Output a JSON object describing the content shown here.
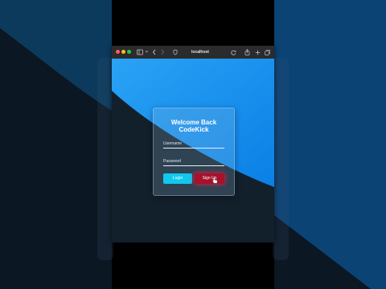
{
  "browser": {
    "address": "localhost",
    "toolbar_icons": {
      "sidebar": "sidebar-icon",
      "back": "chevron-left-icon",
      "forward": "chevron-right-icon",
      "shield": "shield-icon",
      "reload": "reload-icon",
      "share": "share-icon",
      "new_tab": "plus-icon",
      "tabs": "tabs-icon"
    }
  },
  "login": {
    "title_line1": "Welcome Back",
    "title_line2": "CodeKick",
    "username_placeholder": "Username",
    "password_placeholder": "Password",
    "login_label": "Login",
    "signup_label": "Sign Up"
  },
  "colors": {
    "page_blue": "#2196f3",
    "page_dark": "#12202c",
    "login_button": "#10c8ee",
    "signup_button": "#a8102c",
    "signup_glow": "#e61e46"
  }
}
